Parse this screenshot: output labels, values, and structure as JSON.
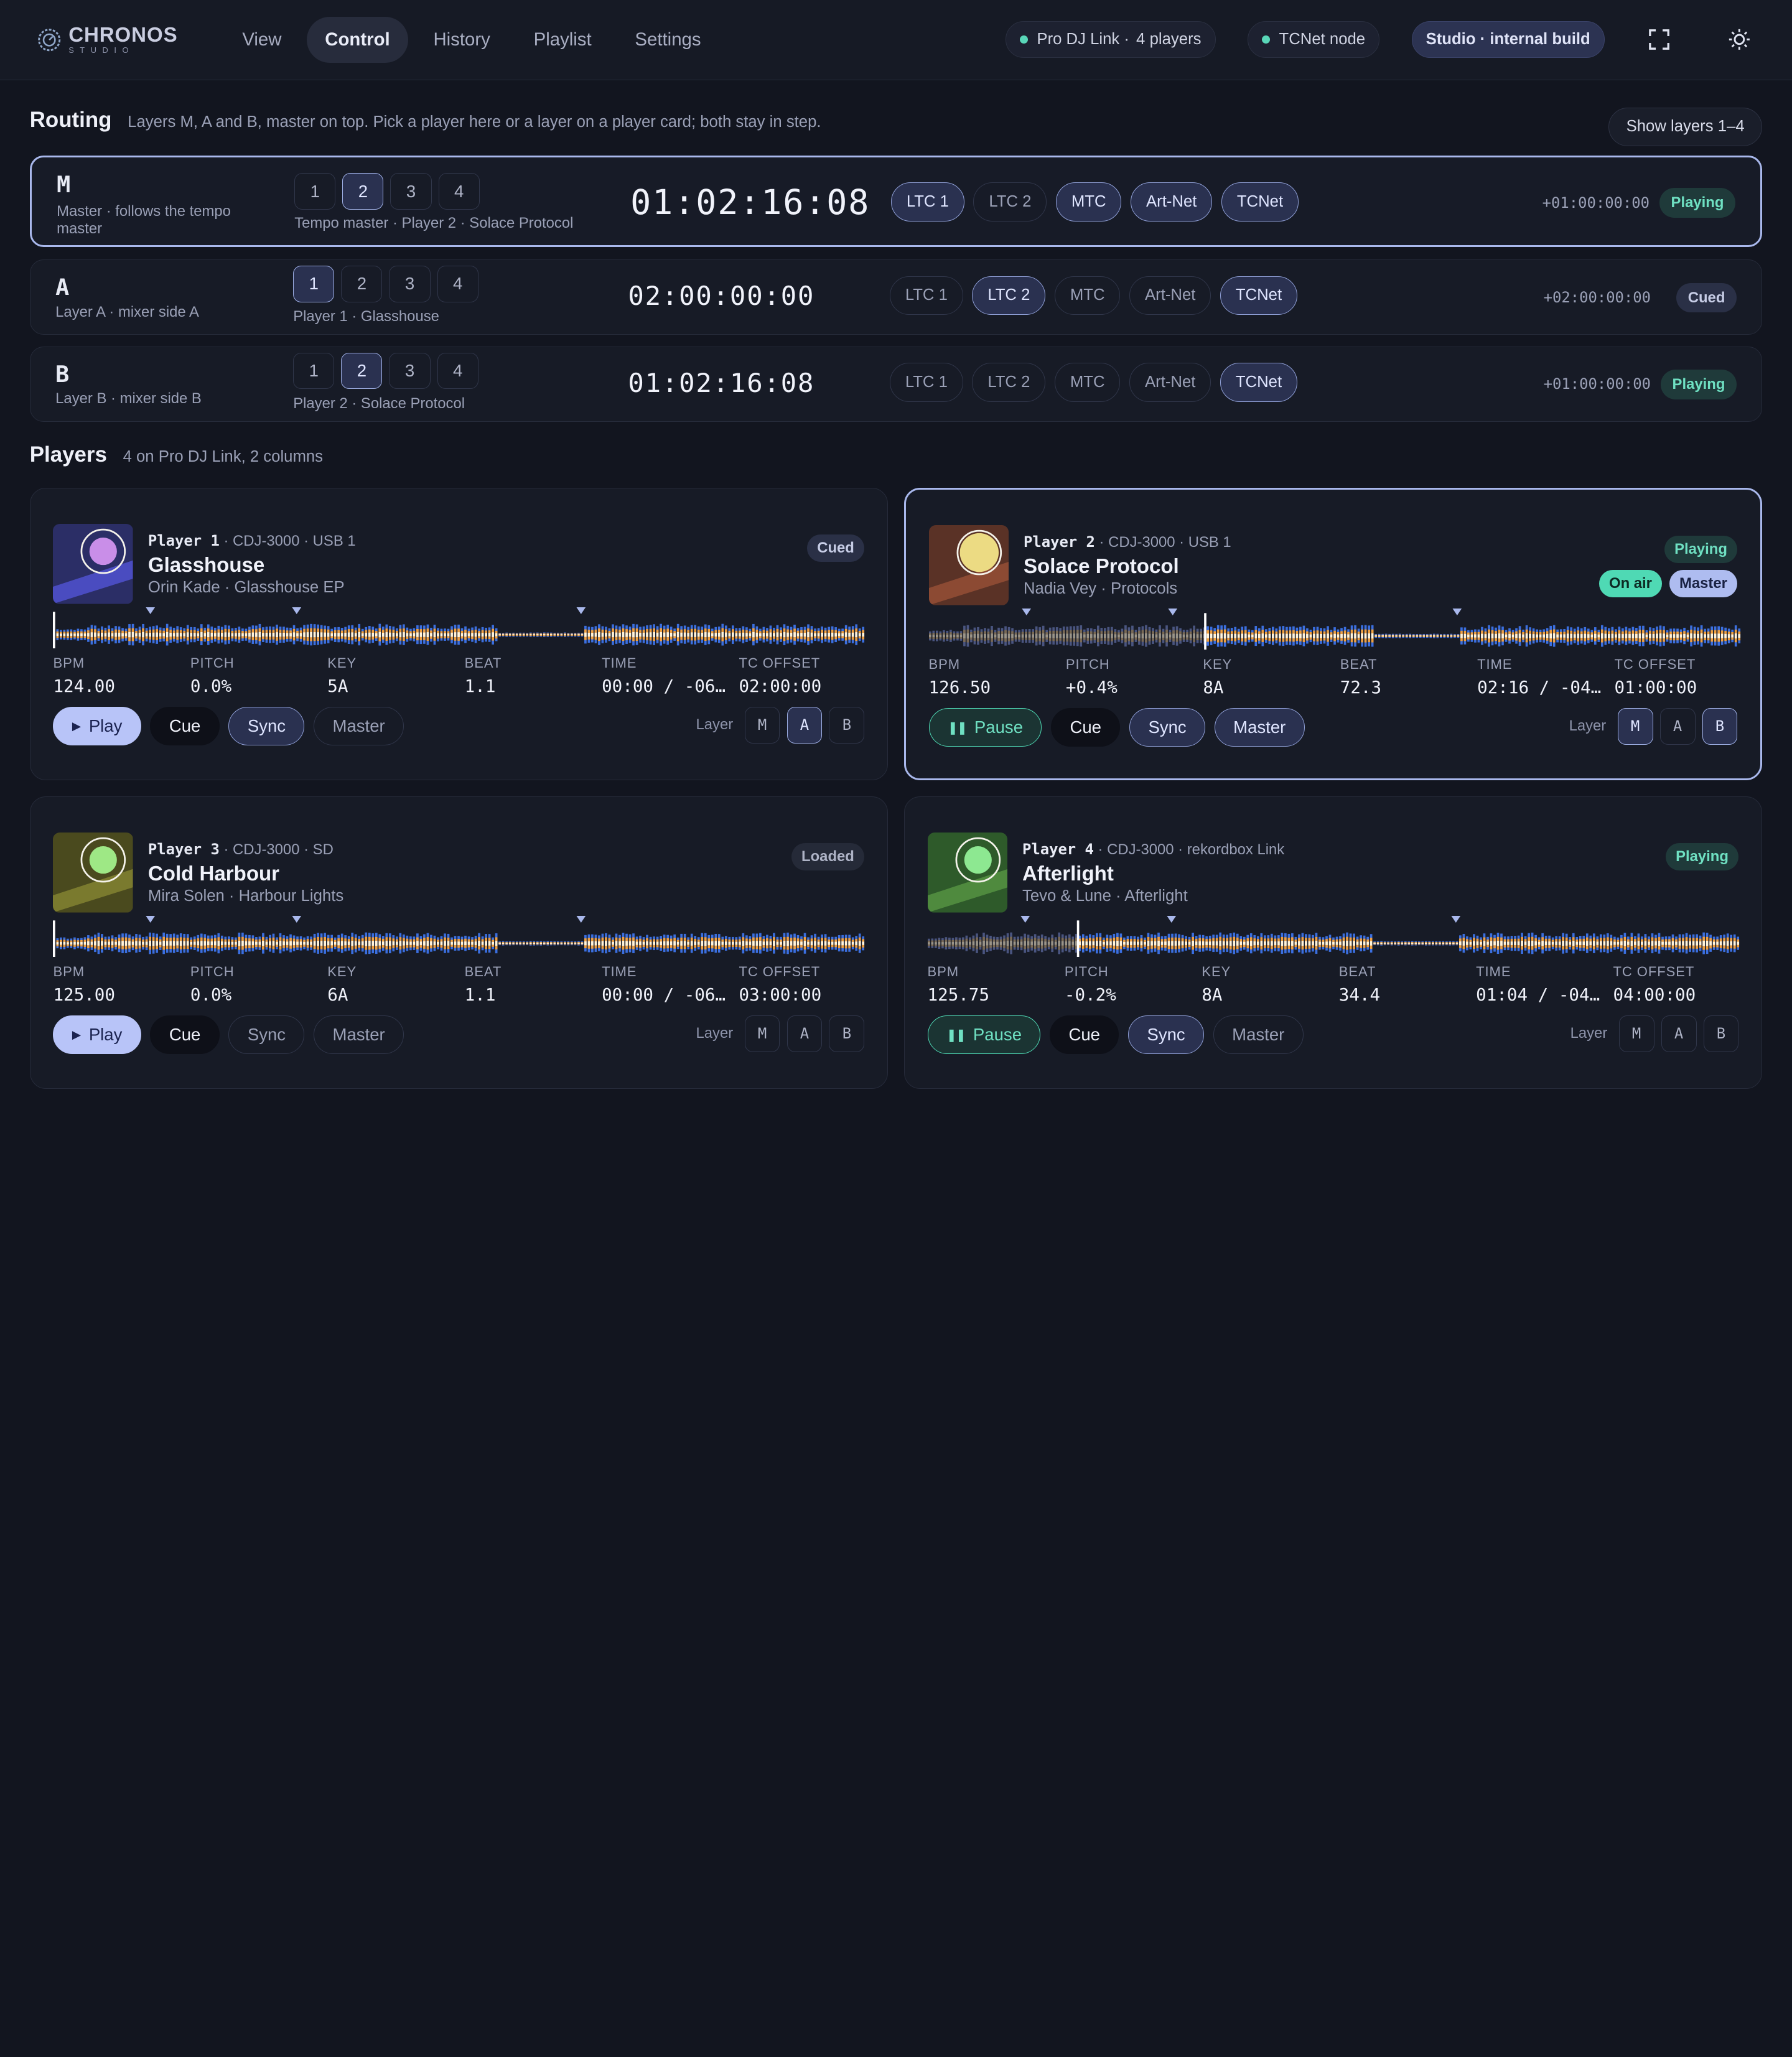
{
  "app": {
    "name": "CHRONOS",
    "sub": "STUDIO"
  },
  "nav": {
    "tabs": [
      "View",
      "Control",
      "History",
      "Playlist",
      "Settings"
    ],
    "active": "Control"
  },
  "top": {
    "link_label": "Pro DJ Link ·",
    "link_count": "4",
    "link_unit": "players",
    "tcnet": "TCNet node",
    "build": "Studio · internal build"
  },
  "routing": {
    "title": "Routing",
    "subtitle": "Layers M, A and B, master on top. Pick a player here or a layer on a player card; both stay in step.",
    "show_layers": "Show layers 1–4",
    "player_numbers": [
      "1",
      "2",
      "3",
      "4"
    ],
    "outputs": [
      "LTC 1",
      "LTC 2",
      "MTC",
      "Art-Net",
      "TCNet"
    ],
    "layers": [
      {
        "letter": "M",
        "desc": "Master · follows the tempo master",
        "selected": 2,
        "note": "Tempo master · Player 2 · Solace Protocol",
        "tc": "01:02:16:08",
        "outputs_on": [
          0,
          2,
          3,
          4
        ],
        "offset": "+01:00:00:00",
        "status": "Playing"
      },
      {
        "letter": "A",
        "desc": "Layer A · mixer side A",
        "selected": 1,
        "note": "Player 1 · Glasshouse",
        "tc": "02:00:00:00",
        "outputs_on": [
          1,
          4
        ],
        "offset": "+02:00:00:00",
        "status": "Cued"
      },
      {
        "letter": "B",
        "desc": "Layer B · mixer side B",
        "selected": 2,
        "note": "Player 2 · Solace Protocol",
        "tc": "01:02:16:08",
        "outputs_on": [
          4
        ],
        "offset": "+01:00:00:00",
        "status": "Playing"
      }
    ]
  },
  "players": {
    "title": "Players",
    "subtitle": "4 on Pro DJ Link, 2 columns",
    "stat_labels": [
      "BPM",
      "PITCH",
      "KEY",
      "BEAT",
      "TIME",
      "TC OFFSET"
    ],
    "buttons": {
      "play": "Play",
      "pause": "Pause",
      "cue": "Cue",
      "sync": "Sync",
      "master": "Master",
      "layer": "Layer"
    },
    "layer_letters": [
      "M",
      "A",
      "B"
    ],
    "cards": [
      {
        "id": "Player 1",
        "meta": "· CDJ-3000 · USB 1",
        "title": "Glasshouse",
        "artist": "Orin Kade · Glasshouse EP",
        "status": "Cued",
        "on_air": false,
        "is_master": false,
        "playing": false,
        "progress": 0.0,
        "stats": [
          "124.00",
          "0.0%",
          "5A",
          "1.1",
          "00:00 / -06…",
          "02:00:00"
        ],
        "sync_on": true,
        "master_on": false,
        "layers_on": [
          "A"
        ],
        "art": {
          "bg": "#2b2e66",
          "disc": "#c98ee8",
          "stripe": "#4a4cc0"
        }
      },
      {
        "id": "Player 2",
        "meta": "· CDJ-3000 · USB 1",
        "title": "Solace Protocol",
        "artist": "Nadia Vey · Protocols",
        "status": "Playing",
        "on_air": true,
        "is_master": true,
        "playing": true,
        "progress": 0.34,
        "stats": [
          "126.50",
          "+0.4%",
          "8A",
          "72.3",
          "02:16 / -04…",
          "01:00:00"
        ],
        "sync_on": true,
        "master_on": true,
        "layers_on": [
          "M",
          "B"
        ],
        "art": {
          "bg": "#5a3226",
          "disc": "#ecdb83",
          "stripe": "#8c4a33"
        }
      },
      {
        "id": "Player 3",
        "meta": "· CDJ-3000 · SD",
        "title": "Cold Harbour",
        "artist": "Mira Solen · Harbour Lights",
        "status": "Loaded",
        "on_air": false,
        "is_master": false,
        "playing": false,
        "progress": 0.0,
        "stats": [
          "125.00",
          "0.0%",
          "6A",
          "1.1",
          "00:00 / -06…",
          "03:00:00"
        ],
        "sync_on": false,
        "master_on": false,
        "layers_on": [],
        "art": {
          "bg": "#4a4a1e",
          "disc": "#9ee885",
          "stripe": "#7a7a2e"
        }
      },
      {
        "id": "Player 4",
        "meta": "· CDJ-3000 · rekordbox Link",
        "title": "Afterlight",
        "artist": "Tevo & Lune · Afterlight",
        "status": "Playing",
        "on_air": false,
        "is_master": false,
        "playing": true,
        "progress": 0.185,
        "stats": [
          "125.75",
          "-0.2%",
          "8A",
          "34.4",
          "01:04 / -04…",
          "04:00:00"
        ],
        "sync_on": true,
        "master_on": false,
        "layers_on": [],
        "art": {
          "bg": "#2e5a2a",
          "disc": "#8de891",
          "stripe": "#4f8a3e"
        }
      }
    ]
  },
  "colors": {
    "accent": "#a9b8ec",
    "playing": "#6fe0c2",
    "wave_blue": "#3b6fe0",
    "wave_orange": "#f0a040",
    "wave_white": "#fff4dc"
  }
}
